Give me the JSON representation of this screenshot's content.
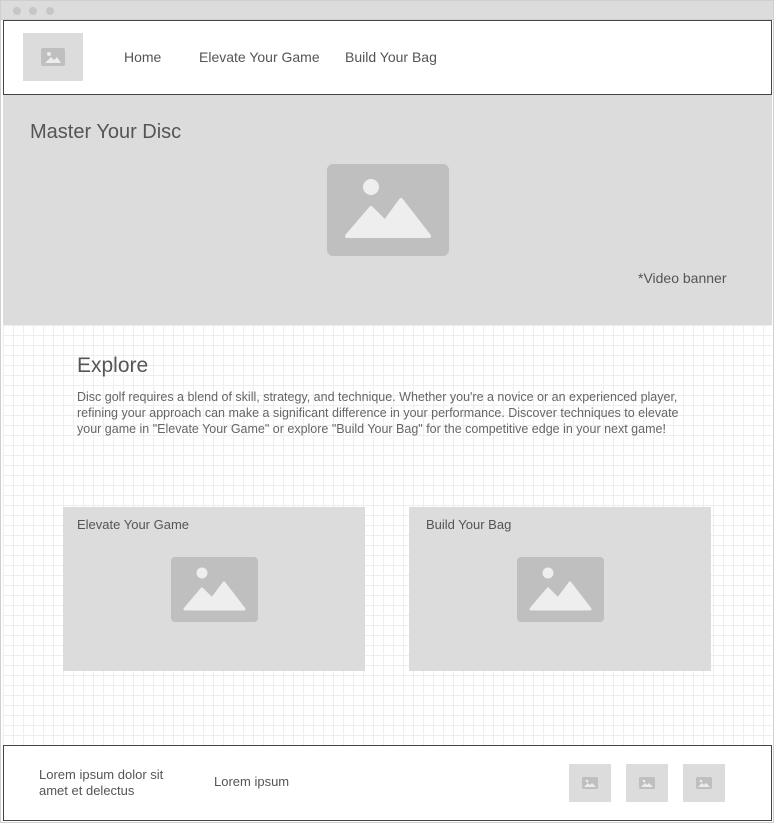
{
  "nav": {
    "logo_icon": "image-icon",
    "links": [
      "Home",
      "Elevate Your Game",
      "Build Your Bag"
    ]
  },
  "hero": {
    "title": "Master Your Disc",
    "image_icon": "image-icon",
    "note": "*Video banner"
  },
  "explore": {
    "title": "Explore",
    "text": "Disc golf requires a blend of skill, strategy, and technique. Whether you're a novice or an experienced player, refining your approach can make a significant difference in your performance. Discover techniques to elevate your game in \"Elevate Your Game\" or explore \"Build Your Bag\" for the competitive edge in your next game!"
  },
  "cards": [
    {
      "title": "Elevate Your Game",
      "icon": "image-icon"
    },
    {
      "title": "Build Your Bag",
      "icon": "image-icon"
    }
  ],
  "footer": {
    "text1": "Lorem ipsum dolor sit amet et delectus",
    "text2": "Lorem ipsum",
    "icons": [
      "image-icon",
      "image-icon",
      "image-icon"
    ]
  },
  "colors": {
    "placeholder_bg": "#dcdcdc",
    "placeholder_icon": "#bfbfbf",
    "border": "#444444",
    "text": "#555555"
  }
}
